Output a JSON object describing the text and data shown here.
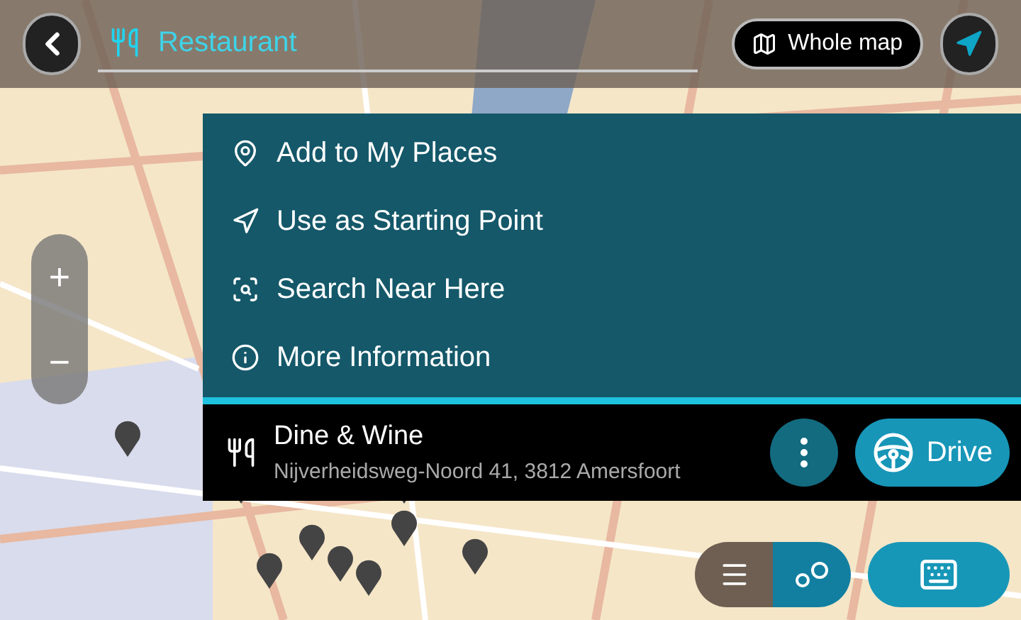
{
  "search_bar": {
    "category": "Restaurant"
  },
  "whole_map_button": "Whole map",
  "zoom": {
    "plus": "+",
    "minus": "−"
  },
  "menu": [
    {
      "kind": "place",
      "label": "Add to My Places"
    },
    {
      "kind": "start",
      "label": "Use as Starting Point"
    },
    {
      "kind": "near",
      "label": "Search Near Here"
    },
    {
      "kind": "info",
      "label": "More Information"
    }
  ],
  "result": {
    "name": "Dine & Wine",
    "address": "Nijverheidsweg-Noord 41, 3812 Amersfoort",
    "drive_button": "Drive"
  },
  "view_toggle": [
    {
      "kind": "list",
      "selected": false
    },
    {
      "kind": "pins",
      "selected": true
    }
  ]
}
